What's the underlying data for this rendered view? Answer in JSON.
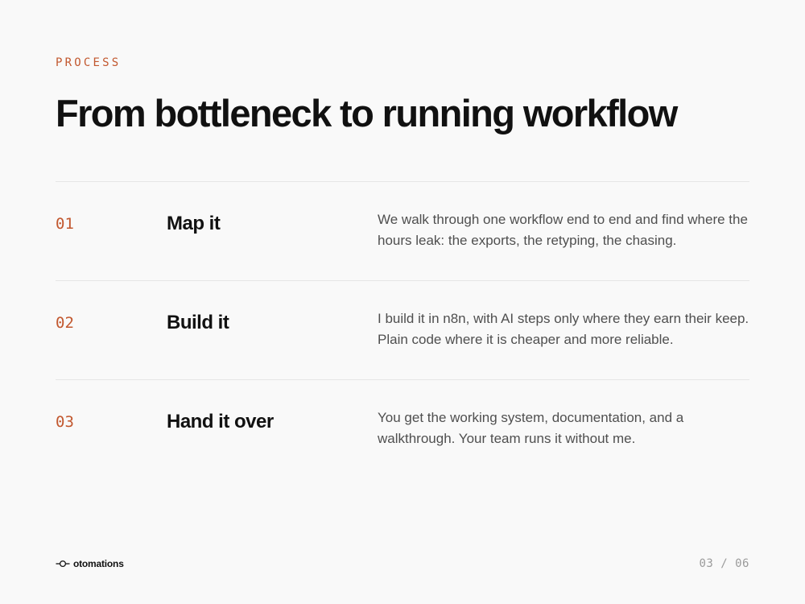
{
  "slide": {
    "eyebrow": "PROCESS",
    "title": "From bottleneck to running workflow"
  },
  "steps": [
    {
      "number": "01",
      "title": "Map it",
      "description": "We walk through one workflow end to end and find where the hours leak: the exports, the retyping, the chasing."
    },
    {
      "number": "02",
      "title": "Build it",
      "description": "I build it in n8n, with AI steps only where they earn their keep. Plain code where it is cheaper and more reliable."
    },
    {
      "number": "03",
      "title": "Hand it over",
      "description": "You get the working system, documentation, and a walkthrough. Your team runs it without me."
    }
  ],
  "footer": {
    "brand": "otomations",
    "brand_icon": "node-line-icon",
    "page": "03 / 06"
  },
  "colors": {
    "accent": "#c2582f",
    "background": "#f9f9f9",
    "text": "#111111",
    "muted_text": "#4f4f4f",
    "divider": "#e6e6e6",
    "page_number": "#9b9b9b"
  }
}
